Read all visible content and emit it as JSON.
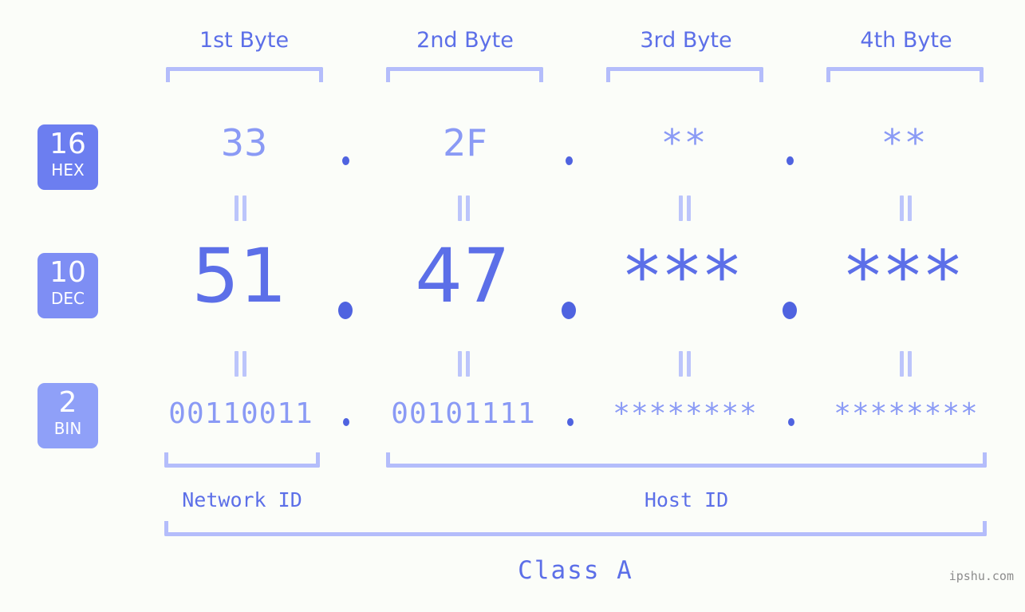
{
  "page": {
    "background_color": "#fbfdf9",
    "accent_dark": "#5c6fe8",
    "accent_mid": "#8a9af5",
    "accent_light": "#b4bdfb",
    "dot_color": "#4f63e0"
  },
  "columns": [
    {
      "id": "byte1",
      "label": "1st Byte"
    },
    {
      "id": "byte2",
      "label": "2nd Byte"
    },
    {
      "id": "byte3",
      "label": "3rd Byte"
    },
    {
      "id": "byte4",
      "label": "4th Byte"
    }
  ],
  "bases": [
    {
      "id": "hex",
      "number": "16",
      "name": "HEX",
      "badge_color": "#6c7ef0"
    },
    {
      "id": "dec",
      "number": "10",
      "name": "DEC",
      "badge_color": "#7e8ef4"
    },
    {
      "id": "bin",
      "number": "2",
      "name": "BIN",
      "badge_color": "#8fa0f8"
    }
  ],
  "rows": {
    "hex": {
      "base_number": "16",
      "base_name": "HEX",
      "values": [
        "33",
        "2F",
        "**",
        "**"
      ],
      "separators": [
        ".",
        ".",
        "."
      ]
    },
    "dec": {
      "base_number": "10",
      "base_name": "DEC",
      "values": [
        "51",
        "47",
        "***",
        "***"
      ],
      "separators": [
        ".",
        ".",
        "."
      ]
    },
    "bin": {
      "base_number": "2",
      "base_name": "BIN",
      "values": [
        "00110011",
        "00101111",
        "********",
        "********"
      ],
      "separators": [
        ".",
        ".",
        "."
      ]
    }
  },
  "equals_marks": {
    "symbol": "=",
    "count_per_row": 4,
    "rows": [
      "hex-to-dec",
      "dec-to-bin"
    ]
  },
  "segments": {
    "network_id": {
      "label": "Network ID",
      "bytes": [
        "1st Byte"
      ]
    },
    "host_id": {
      "label": "Host ID",
      "bytes": [
        "2nd Byte",
        "3rd Byte",
        "4th Byte"
      ]
    }
  },
  "class": {
    "label": "Class A"
  },
  "watermark": {
    "text": "ipshu.com"
  }
}
